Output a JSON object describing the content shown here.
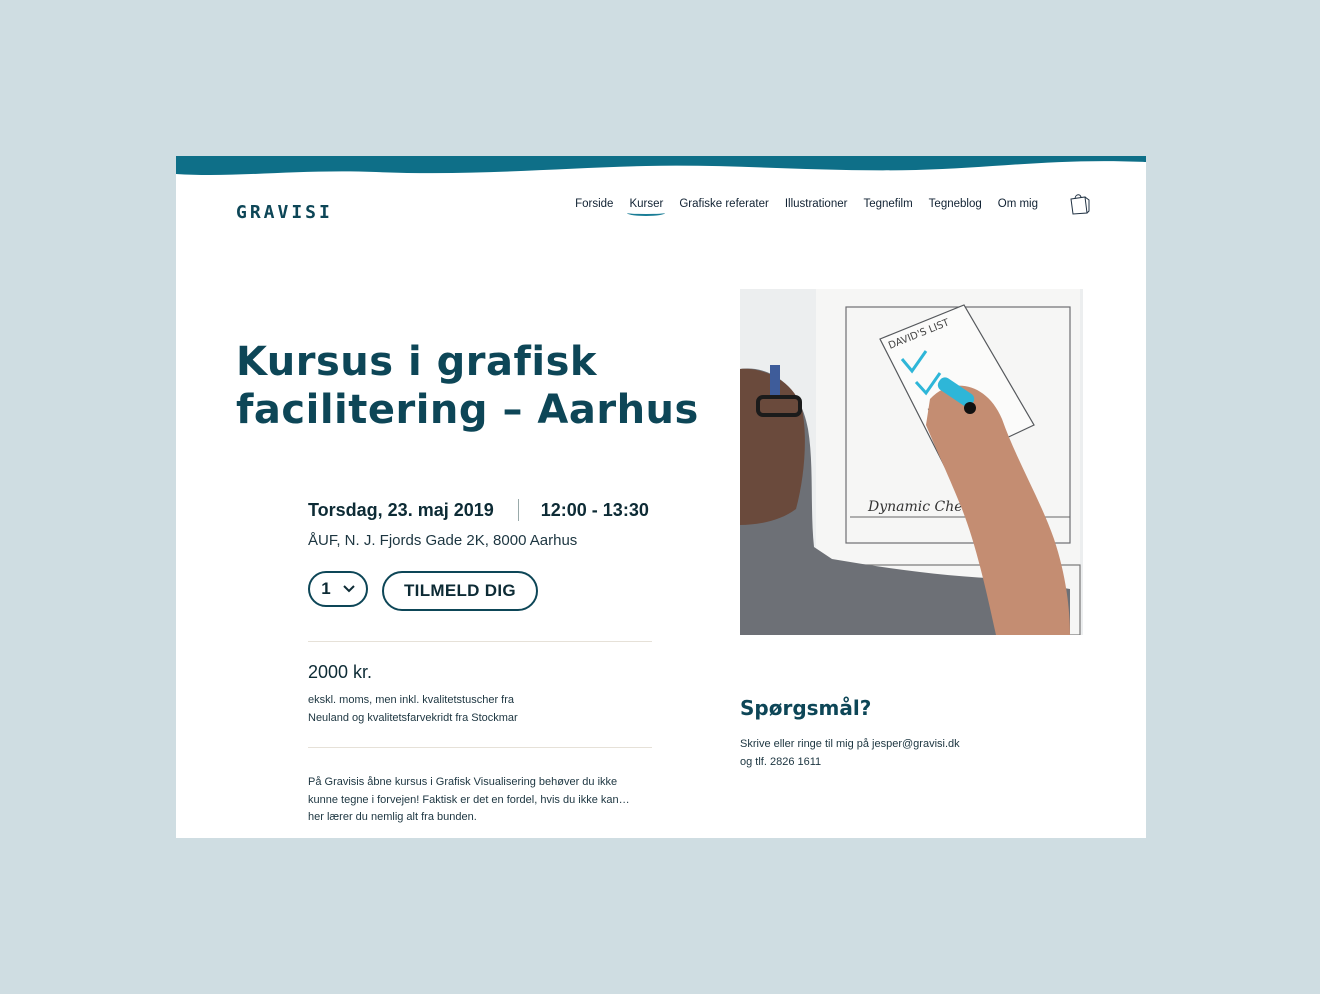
{
  "brand": {
    "logo": "GRAVISI"
  },
  "nav": {
    "items": [
      "Forside",
      "Kurser",
      "Grafiske referater",
      "Illustrationer",
      "Tegnefilm",
      "Tegneblog",
      "Om mig"
    ],
    "active": "Kurser",
    "cart_icon": "shopping-bag-icon"
  },
  "course": {
    "title": "Kursus i grafisk facilitering – Aarhus",
    "date": "Torsdag, 23. maj 2019",
    "time": "12:00 - 13:30",
    "address": "ÅUF, N. J. Fjords Gade 2K, 8000 Aarhus",
    "quantity": "1",
    "signup_label": "TILMELD DIG",
    "price": "2000 kr.",
    "price_note": "ekskl. moms, men inkl. kvalitetstuscher fra Neuland og kvalitetsfarvekridt fra Stockmar",
    "description": "På Gravisis åbne kursus i Grafisk Visualisering behøver du ikke kunne tegne i forvejen! Faktisk er det en fordel, hvis du ikke kan…  her lærer du nemlig alt fra bunden."
  },
  "photo": {
    "list_title": "DAVID'S LIST",
    "caption": "Dynamic Checklist"
  },
  "questions": {
    "title": "Spørgsmål?",
    "line1": "Skrive eller ringe til mig på jesper@gravisi.dk",
    "line2": "og  tlf. 2826 1611"
  },
  "colors": {
    "accent": "#0e6f88",
    "text": "#0d4657",
    "background": "#cfdde2"
  }
}
